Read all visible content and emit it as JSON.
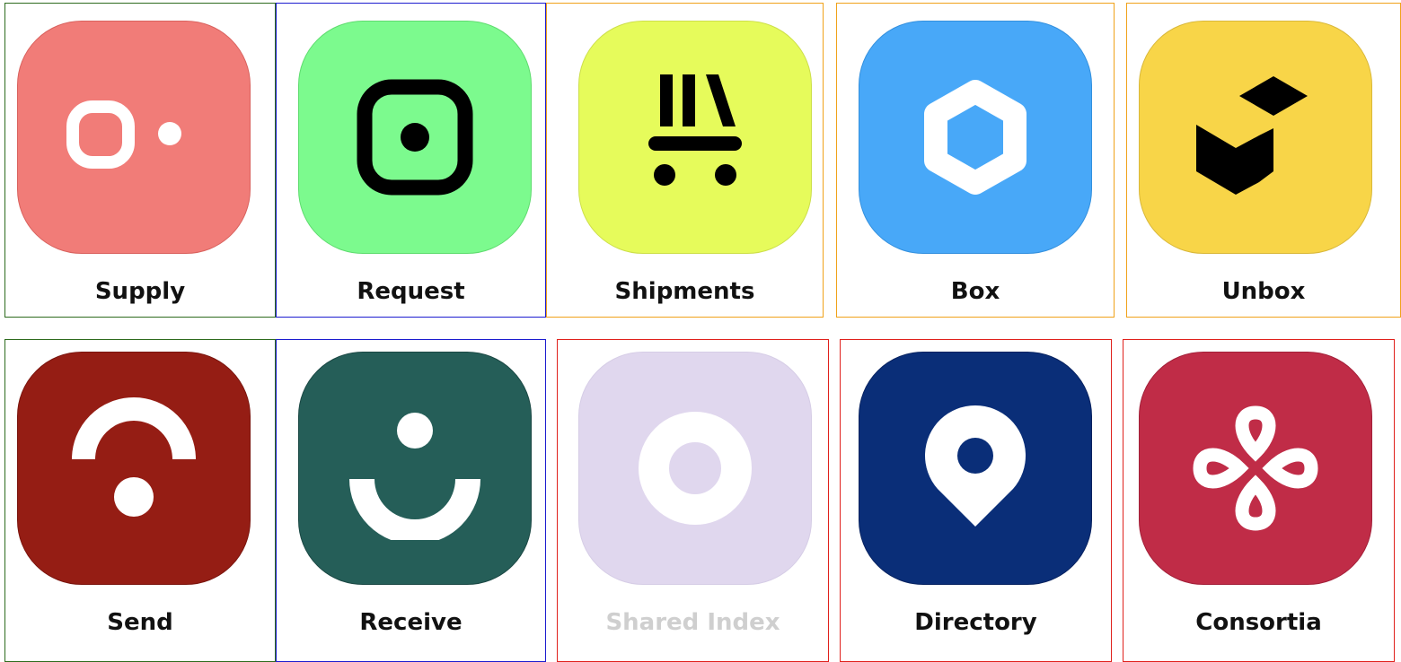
{
  "apps": [
    {
      "label": "Supply",
      "icon": "supply-icon",
      "bg": "#f17c78"
    },
    {
      "label": "Request",
      "icon": "request-icon",
      "bg": "#7cfa8e"
    },
    {
      "label": "Shipments",
      "icon": "shipments-icon",
      "bg": "#e6fb5b"
    },
    {
      "label": "Box",
      "icon": "box-icon",
      "bg": "#48a8f8"
    },
    {
      "label": "Unbox",
      "icon": "unbox-icon",
      "bg": "#f8d548"
    },
    {
      "label": "Send",
      "icon": "send-icon",
      "bg": "#951d14"
    },
    {
      "label": "Receive",
      "icon": "receive-icon",
      "bg": "#255e58"
    },
    {
      "label": "Shared Index",
      "icon": "shared-index-icon",
      "bg": "#e0d7ee",
      "disabled": true
    },
    {
      "label": "Directory",
      "icon": "directory-icon",
      "bg": "#0a2e78"
    },
    {
      "label": "Consortia",
      "icon": "consortia-icon",
      "bg": "#c02c47"
    }
  ]
}
